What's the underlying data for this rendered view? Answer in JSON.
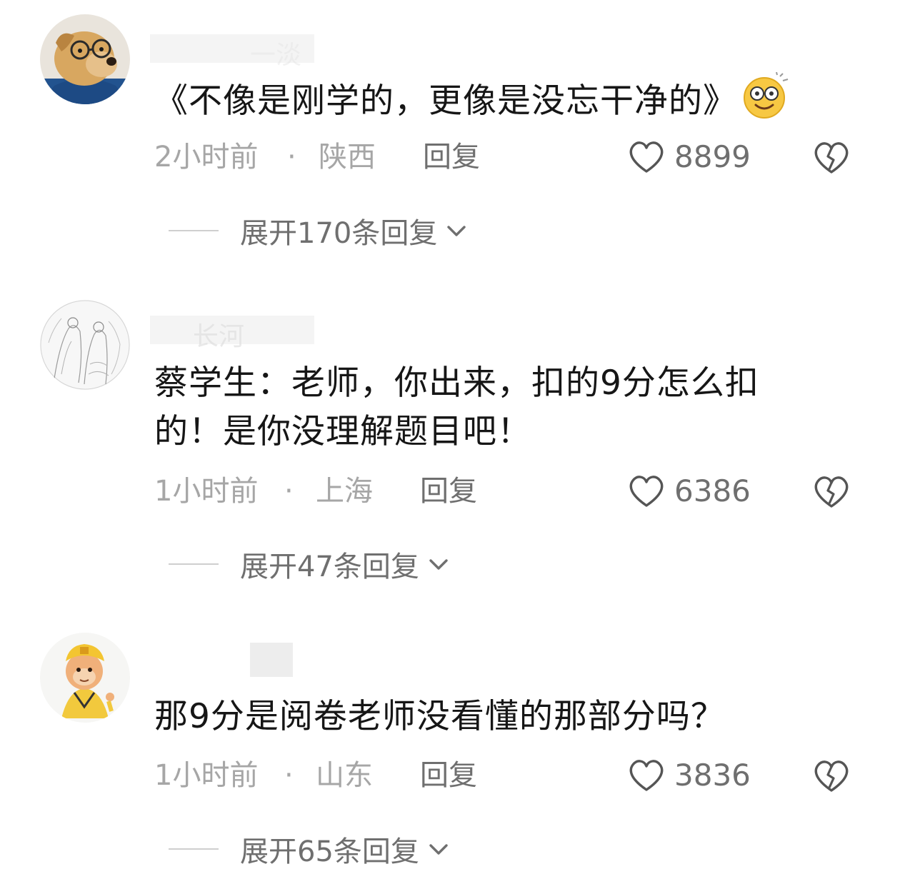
{
  "comments": [
    {
      "username": "一淡",
      "text": "《不像是刚学的，更像是没忘干净的》",
      "time": "2小时前",
      "location": "陕西",
      "reply": "回复",
      "likes": "8899",
      "expand": "展开170条回复"
    },
    {
      "username": "长河",
      "text_line1": "蔡学生：老师，你出来，扣的9分怎么扣",
      "text_line2": "的！是你没理解题目吧！",
      "time": "1小时前",
      "location": "上海",
      "reply": "回复",
      "likes": "6386",
      "expand": "展开47条回复"
    },
    {
      "username": "",
      "text": "那9分是阅卷老师没看懂的那部分吗？",
      "time": "1小时前",
      "location": "山东",
      "reply": "回复",
      "likes": "3836",
      "expand": "展开65条回复"
    }
  ],
  "icons": {
    "like": "heart-outline-icon",
    "dislike": "broken-heart-icon",
    "expand": "chevron-down-icon",
    "emoji": "dizzy-face-emoji"
  }
}
